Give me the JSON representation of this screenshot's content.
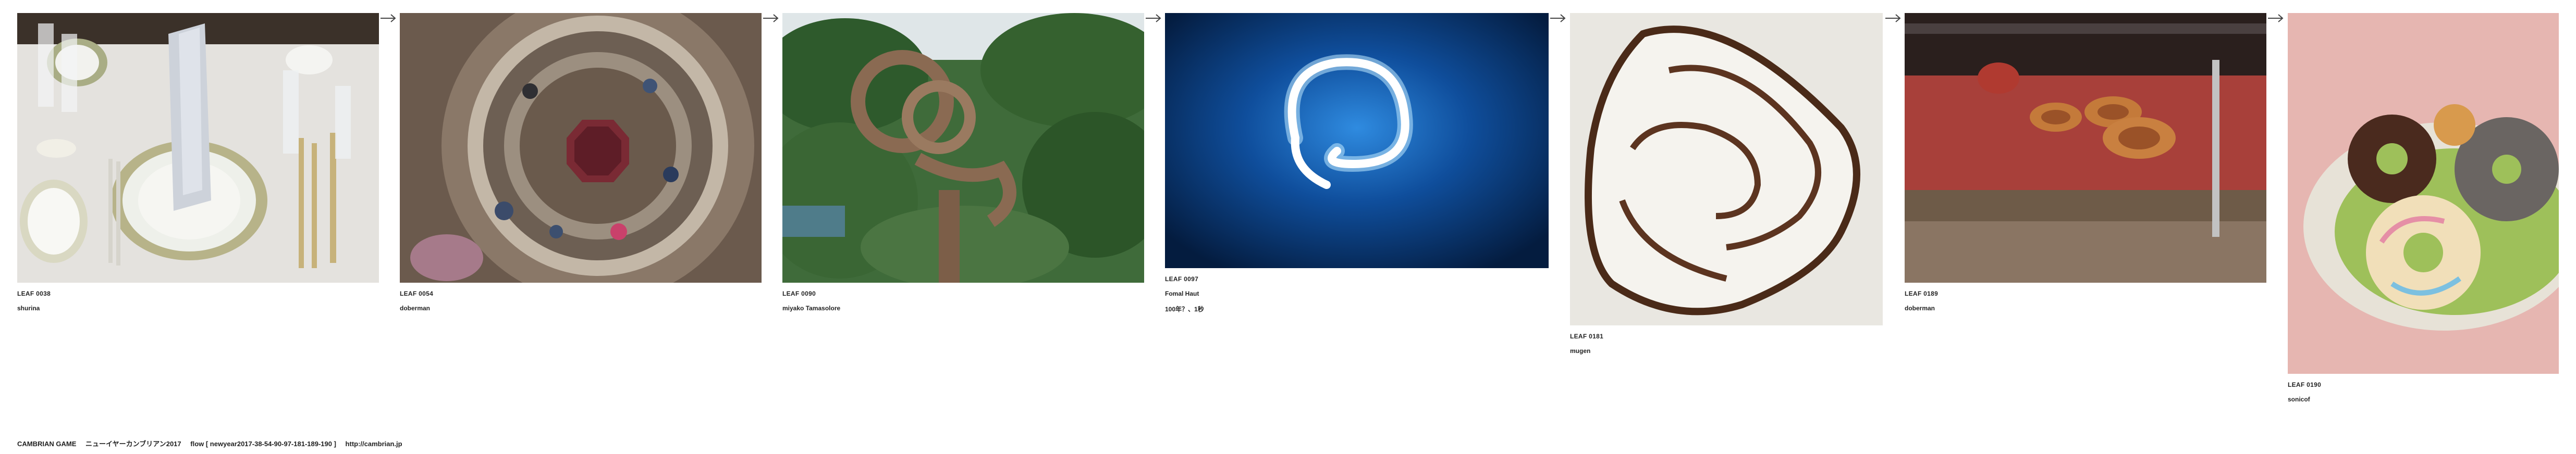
{
  "leaves": [
    {
      "id": "LEAF 0038",
      "author": "shurina",
      "image": "dinner-table-setting-photo"
    },
    {
      "id": "LEAF 0054",
      "author": "doberman",
      "image": "spiral-stairwell-photo"
    },
    {
      "id": "LEAF 0090",
      "author": "miyako Tamasolore",
      "image": "twisted-pine-tree-photo"
    },
    {
      "id": "LEAF 0097",
      "author": "Fomal Haut",
      "caption": "100年？、1秒",
      "image": "glowing-ring-photo"
    },
    {
      "id": "LEAF 0181",
      "author": "mugen",
      "image": "spiral-fishcake-photo"
    },
    {
      "id": "LEAF 0189",
      "author": "doberman",
      "image": "sausage-showcase-photo"
    },
    {
      "id": "LEAF 0190",
      "author": "sonicof",
      "image": "donuts-plate-photo"
    }
  ],
  "arrow_icon": "right-arrow-icon",
  "footer": {
    "game": "CAMBRIAN GAME",
    "title": "ニューイヤーカンブリアン2017",
    "flow": "flow [ newyear2017-38-54-90-97-181-189-190 ]",
    "url": "http://cambrian.jp"
  }
}
